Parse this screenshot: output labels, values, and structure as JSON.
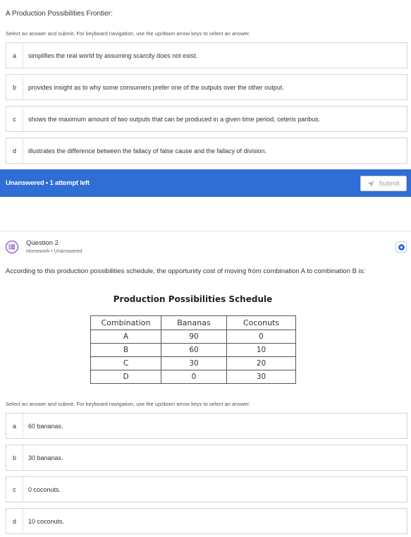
{
  "question1": {
    "title": "A Production Possibilities Frontier:",
    "instructions": "Select an answer and submit. For keyboard navigation, use the up/down arrow keys to select an answer.",
    "options": [
      {
        "letter": "a",
        "text": "simplifies the real world by assuming scarcity does not exist."
      },
      {
        "letter": "b",
        "text": "provides insight as to why some consumers prefer one of the outputs over the other output."
      },
      {
        "letter": "c",
        "text": "shows the maximum amount of two outputs that can be produced in a given time period, ceteris paribus."
      },
      {
        "letter": "d",
        "text": "illustrates the difference between the fallacy of false cause and the fallacy of division."
      }
    ],
    "status": "Unanswered  •  1 attempt left",
    "submit_label": "Submit"
  },
  "question2": {
    "title": "Question 2",
    "subtitle": "Homework  •  Unanswered",
    "prompt": "According to this production possibilities schedule, the opportunity cost of moving from combination A to combination B is:",
    "table": {
      "title": "Production Possibilities Schedule",
      "headers": [
        "Combination",
        "Bananas",
        "Coconuts"
      ],
      "rows": [
        [
          "A",
          "90",
          "0"
        ],
        [
          "B",
          "60",
          "10"
        ],
        [
          "C",
          "30",
          "20"
        ],
        [
          "D",
          "0",
          "30"
        ]
      ]
    },
    "instructions": "Select an answer and submit. For keyboard navigation, use the up/down arrow keys to select an answer.",
    "options": [
      {
        "letter": "a",
        "text": "60 bananas."
      },
      {
        "letter": "b",
        "text": "30 bananas."
      },
      {
        "letter": "c",
        "text": "0 coconuts."
      },
      {
        "letter": "d",
        "text": "10 coconuts."
      }
    ]
  },
  "colors": {
    "status_bar": "#2f6ed4",
    "question_icon": "#7a3bb0",
    "info_icon": "#2f6ed4"
  }
}
